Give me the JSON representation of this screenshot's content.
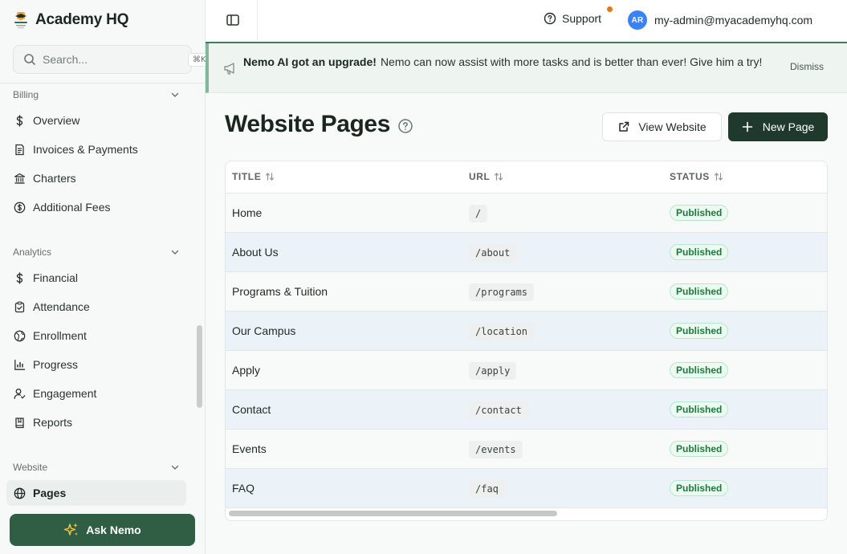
{
  "brand": {
    "name": "Academy HQ"
  },
  "search": {
    "placeholder": "Search...",
    "shortcut": "⌘K"
  },
  "sidebar": {
    "sections": [
      {
        "title": "Billing",
        "items": [
          "Overview",
          "Invoices & Payments",
          "Charters",
          "Additional Fees"
        ]
      },
      {
        "title": "Analytics",
        "items": [
          "Financial",
          "Attendance",
          "Enrollment",
          "Progress",
          "Engagement",
          "Reports"
        ]
      },
      {
        "title": "Website",
        "items": [
          "Pages"
        ]
      }
    ],
    "active_item": "Pages",
    "ask_button": "Ask Nemo"
  },
  "header": {
    "support_label": "Support",
    "user_initials": "AR",
    "user_email": "my-admin@myacademyhq.com"
  },
  "banner": {
    "title": "Nemo AI got an upgrade!",
    "message": "Nemo can now assist with more tasks and is better than ever! Give him a try!",
    "dismiss_label": "Dismiss"
  },
  "page": {
    "title": "Website Pages",
    "view_website_label": "View Website",
    "new_page_label": "New Page"
  },
  "table": {
    "columns": [
      "TITLE",
      "URL",
      "STATUS"
    ],
    "rows": [
      {
        "title": "Home",
        "url": "/",
        "status": "Published"
      },
      {
        "title": "About Us",
        "url": "/about",
        "status": "Published"
      },
      {
        "title": "Programs & Tuition",
        "url": "/programs",
        "status": "Published"
      },
      {
        "title": "Our Campus",
        "url": "/location",
        "status": "Published"
      },
      {
        "title": "Apply",
        "url": "/apply",
        "status": "Published"
      },
      {
        "title": "Contact",
        "url": "/contact",
        "status": "Published"
      },
      {
        "title": "Events",
        "url": "/events",
        "status": "Published"
      },
      {
        "title": "FAQ",
        "url": "/faq",
        "status": "Published"
      }
    ]
  },
  "colors": {
    "accent": "#2f5e44",
    "dark_button": "#1f3a2c",
    "badge_text": "#1b7a3c",
    "notification_dot": "#e07a16",
    "avatar": "#3b82f6"
  }
}
